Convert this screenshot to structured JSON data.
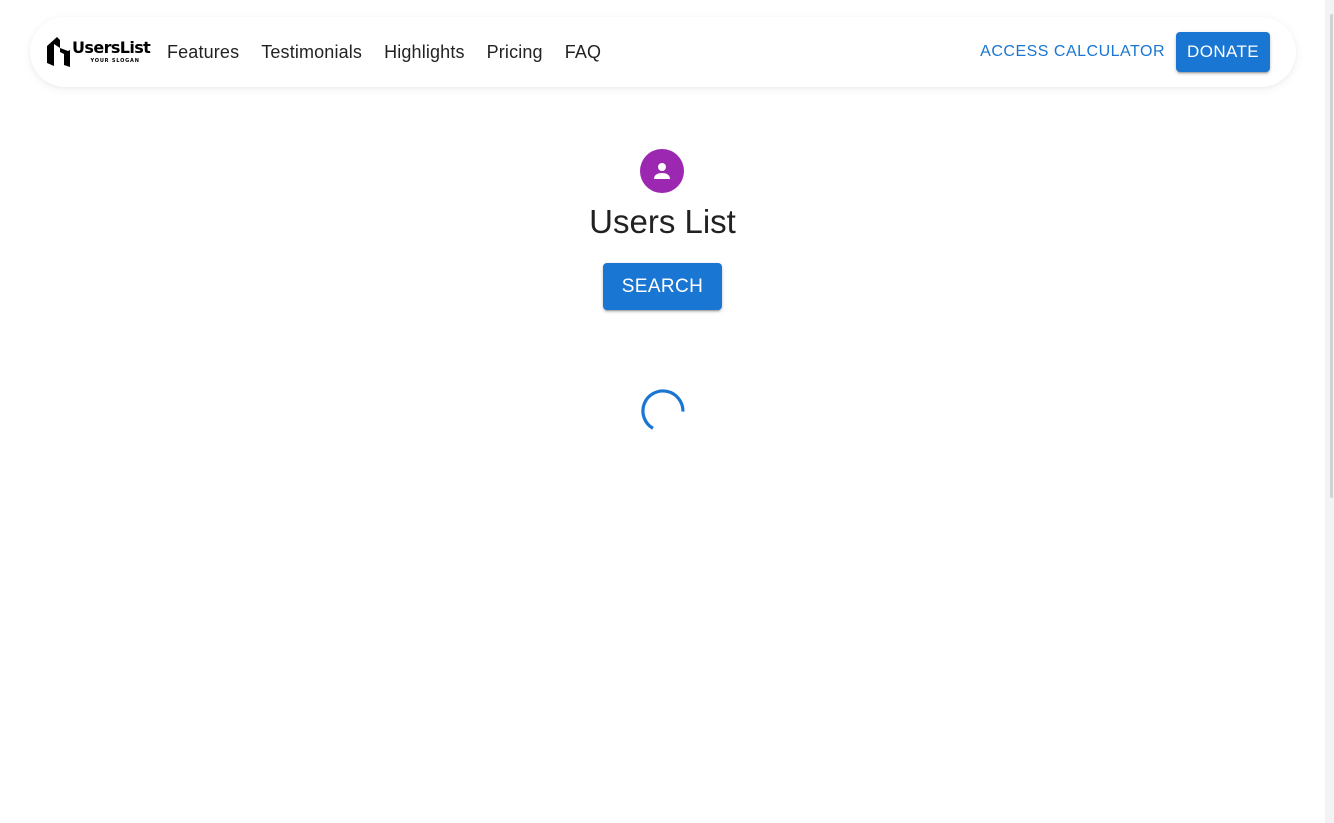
{
  "brand": {
    "name": "UsersList",
    "slogan": "YOUR SLOGAN"
  },
  "nav": {
    "links": [
      {
        "label": "Features"
      },
      {
        "label": "Testimonials"
      },
      {
        "label": "Highlights"
      },
      {
        "label": "Pricing"
      },
      {
        "label": "FAQ"
      }
    ],
    "access_label": "ACCESS CALCULATOR",
    "donate_label": "DONATE"
  },
  "main": {
    "title": "Users List",
    "search_label": "SEARCH"
  },
  "colors": {
    "primary": "#1976d2",
    "avatar": "#9c27b0"
  },
  "icons": {
    "avatar": "person-icon",
    "loading": "loading-spinner-icon"
  }
}
